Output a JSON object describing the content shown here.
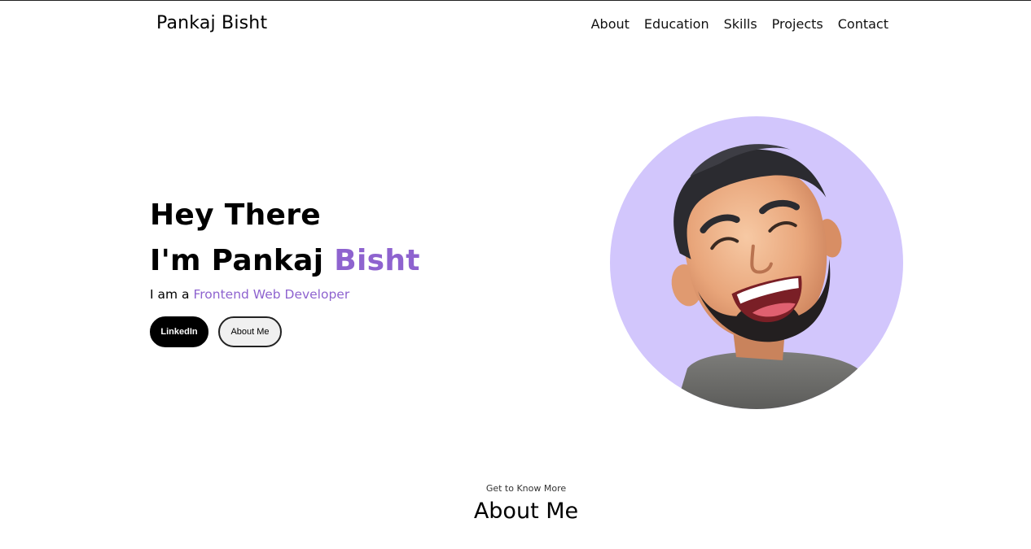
{
  "header": {
    "brand": "Pankaj Bisht",
    "nav": [
      {
        "label": "About"
      },
      {
        "label": "Education"
      },
      {
        "label": "Skills"
      },
      {
        "label": "Projects"
      },
      {
        "label": "Contact"
      }
    ]
  },
  "hero": {
    "line1": "Hey There",
    "line2_prefix": "I'm Pankaj ",
    "line2_accent": "Bisht",
    "subtitle_prefix": "I am a ",
    "subtitle_accent": "Frontend Web Developer",
    "buttons": {
      "linkedin": "LinkedIn",
      "about": "About Me"
    },
    "avatar_icon": "memoji-avatar"
  },
  "about": {
    "kicker": "Get to Know More",
    "title": "About Me"
  },
  "colors": {
    "accent": "#8e63cf",
    "avatar_bg": "#d2c6fc",
    "primary_button": "#000000"
  }
}
